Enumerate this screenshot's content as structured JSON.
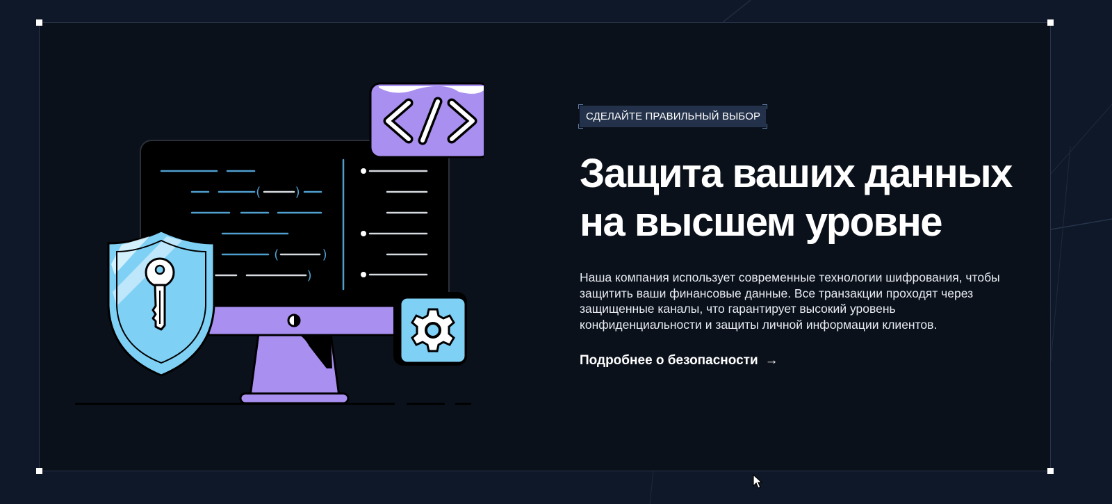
{
  "section": {
    "badge": "СДЕЛАЙТЕ ПРАВИЛЬНЫЙ ВЫБОР",
    "title_line1": "Защита ваших данных",
    "title_line2": "на высшем уровне",
    "description": "Наша компания использует современные технологии шифрования, чтобы защитить ваши финансовые данные. Все транзакции проходят через защищенные каналы, что гарантирует высокий уровень конфиденциальности и защиты личной информации клиентов.",
    "link_label": "Подробнее о безопасности",
    "link_arrow": "→"
  },
  "illustration": {
    "code_tag": "</>",
    "icons": [
      "code-tag-icon",
      "shield-key-icon",
      "gear-icon",
      "monitor-icon"
    ]
  },
  "colors": {
    "page_background": "#0f1828",
    "section_background": "#0b111b",
    "accent_purple": "#a88ff0",
    "accent_blue": "#7fd0f5",
    "code_line_blue": "#4f9fcf",
    "badge_background": "#23324a"
  }
}
